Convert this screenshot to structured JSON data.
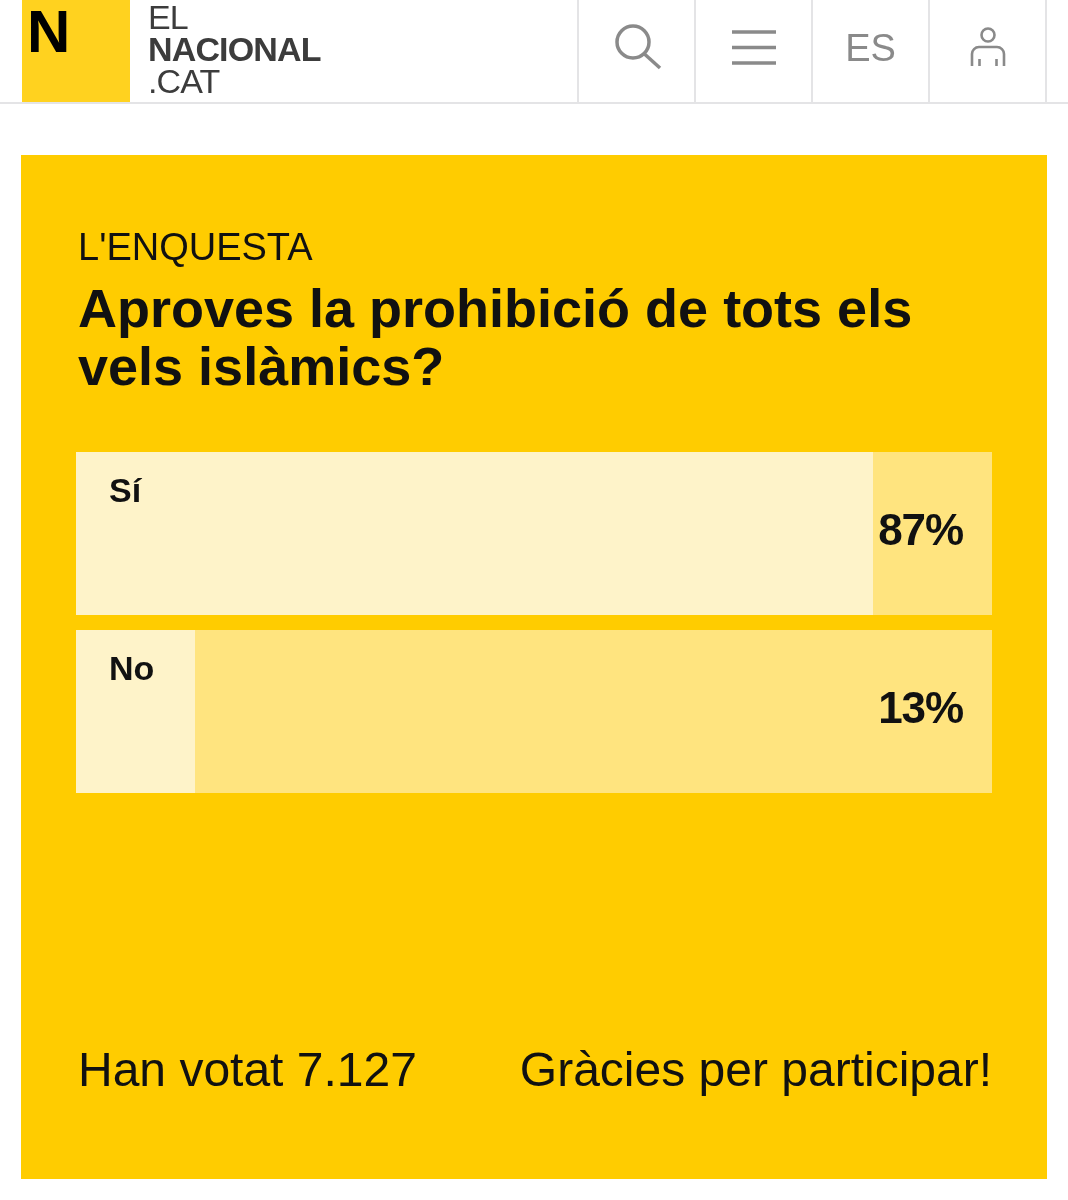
{
  "header": {
    "logo": {
      "mark": "N",
      "lines": [
        {
          "text": "EL",
          "bold": false
        },
        {
          "text": "NACIONAL",
          "bold": true
        },
        {
          "text": ".CAT",
          "bold": false
        }
      ]
    },
    "nav": [
      {
        "kind": "search"
      },
      {
        "kind": "menu"
      },
      {
        "kind": "language",
        "label": "ES"
      },
      {
        "kind": "user"
      }
    ]
  },
  "poll": {
    "kicker": "L'ENQUESTA",
    "question": "Aproves la prohibició de tots els vels islàmics?",
    "options": [
      {
        "label": "Sí",
        "level": 0.87,
        "percent": "87%"
      },
      {
        "label": "No",
        "level": 0.13,
        "percent": "13%"
      }
    ],
    "votes": "Han votat 7.127",
    "thanks": "Gràcies per participar!"
  }
}
